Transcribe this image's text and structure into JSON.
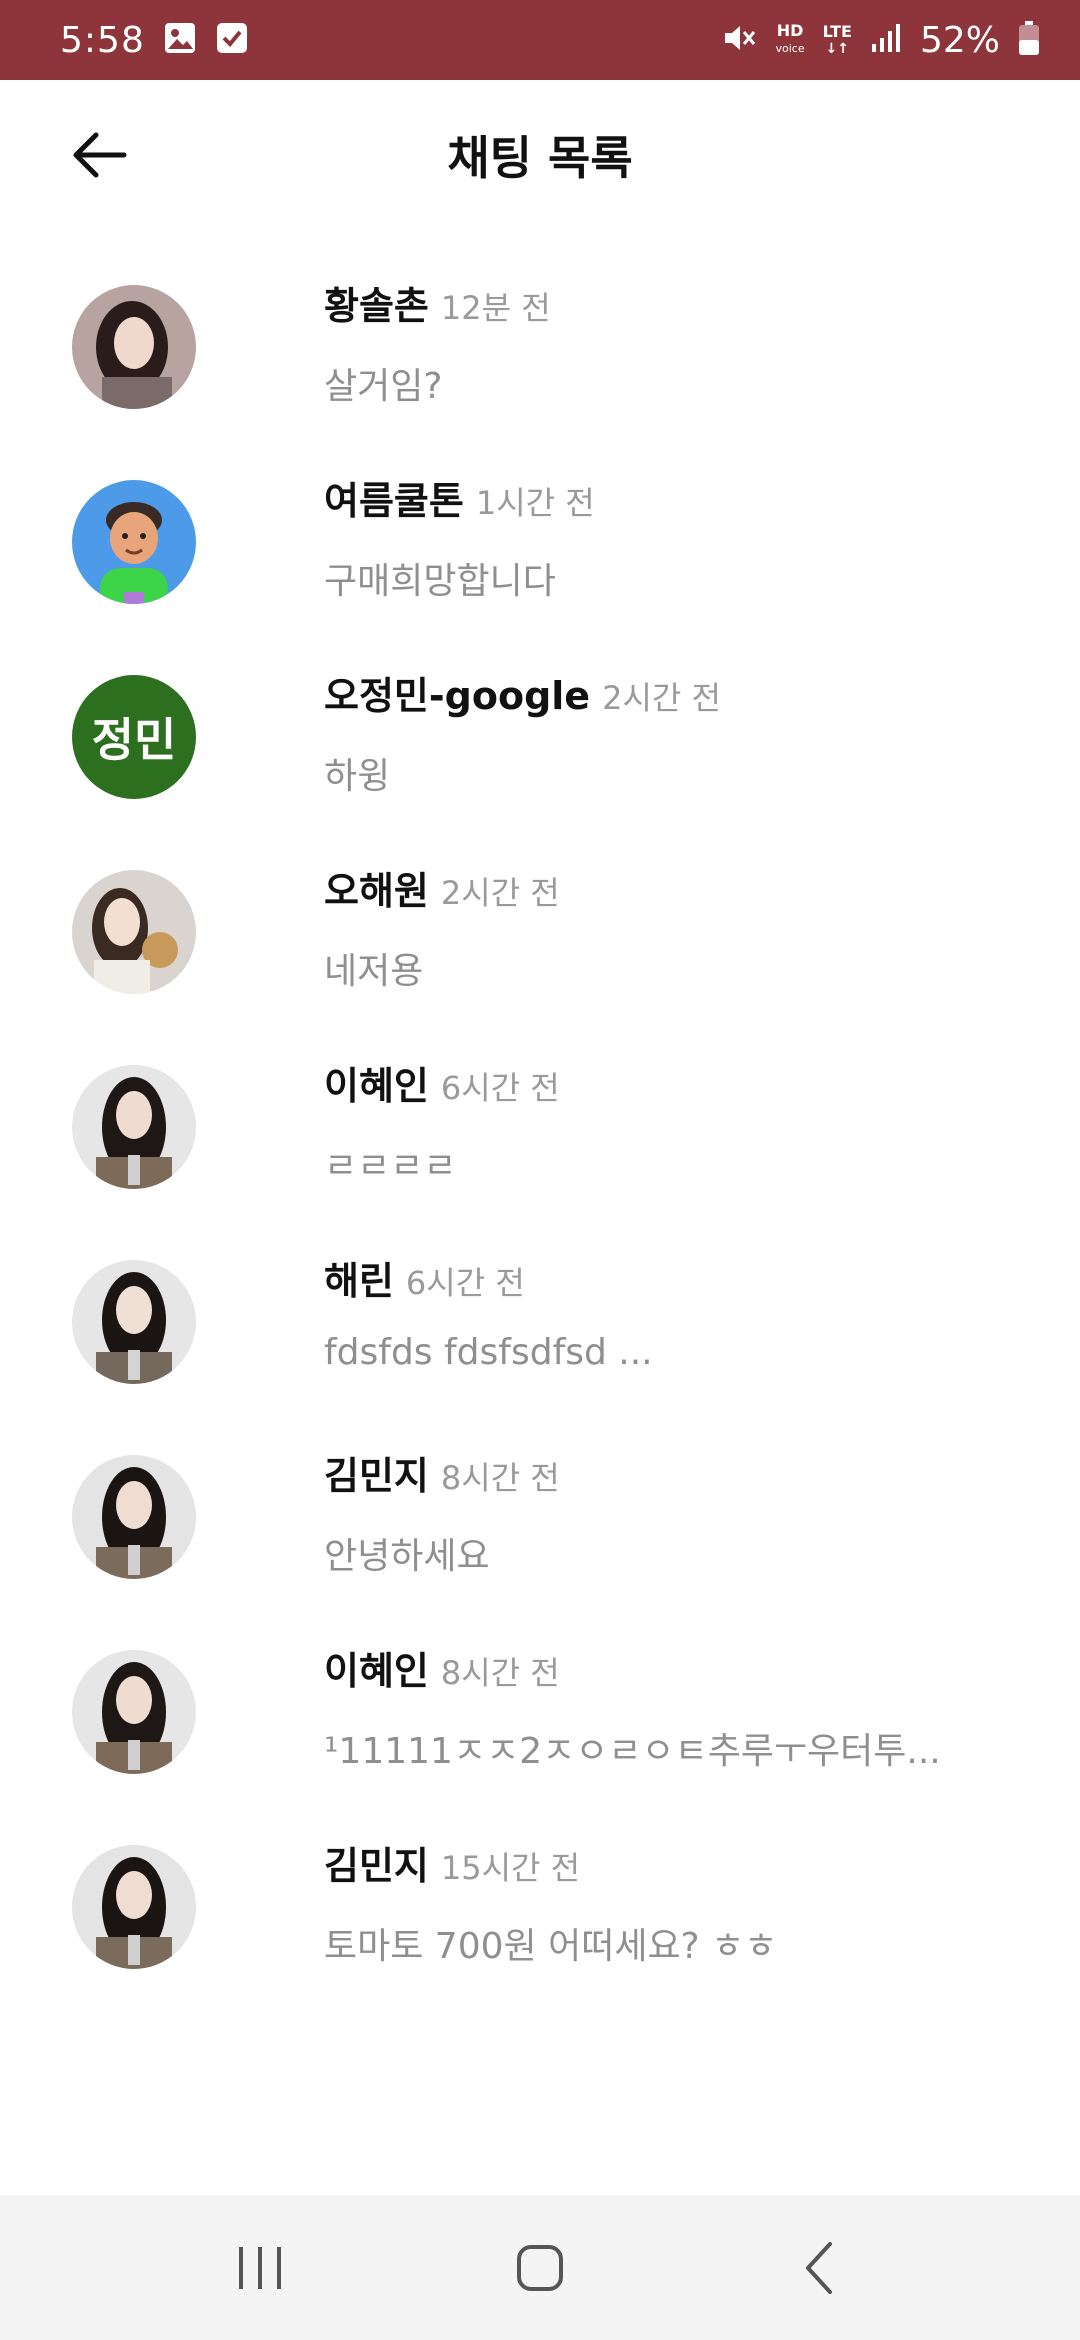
{
  "status_bar": {
    "time": "5:58",
    "hd_label": "HD",
    "voice_label": "voice",
    "lte_label": "LTE",
    "battery_percent": "52%"
  },
  "header": {
    "title": "채팅 목록",
    "back_icon": "arrow-left-icon"
  },
  "chats": [
    {
      "name": "황솔촌",
      "time": "12분 전",
      "preview": "살거임?",
      "avatar": "photo"
    },
    {
      "name": "여름쿨톤",
      "time": "1시간 전",
      "preview": "구매희망합니다",
      "avatar": "cartoon"
    },
    {
      "name": "오정민-google",
      "time": "2시간 전",
      "preview": "하윙",
      "avatar": "initials",
      "initials": "정민"
    },
    {
      "name": "오해원",
      "time": "2시간 전",
      "preview": "네저용",
      "avatar": "photo"
    },
    {
      "name": "이혜인",
      "time": "6시간 전",
      "preview": "ㄹㄹㄹㄹ",
      "avatar": "photo"
    },
    {
      "name": "해린",
      "time": "6시간 전",
      "preview": "fdsfds fdsfsdfsd ...",
      "avatar": "photo"
    },
    {
      "name": "김민지",
      "time": "8시간 전",
      "preview": "안녕하세요",
      "avatar": "photo"
    },
    {
      "name": "이혜인",
      "time": "8시간 전",
      "preview": "¹11111ㅈㅈ2ㅈㅇㄹㅇㅌ추루ㅜ우터투...",
      "avatar": "photo"
    },
    {
      "name": "김민지",
      "time": "15시간 전",
      "preview": "토마토 700원 어떠세요? ㅎㅎ",
      "avatar": "photo"
    }
  ],
  "nav_bar": {
    "recents_icon": "recents-icon",
    "home_icon": "home-icon",
    "back_icon": "back-chevron-icon"
  },
  "colors": {
    "status_bar": "#8e343b",
    "initials_avatar": "#2c6f1e",
    "preview_text": "#8f8f8f"
  }
}
